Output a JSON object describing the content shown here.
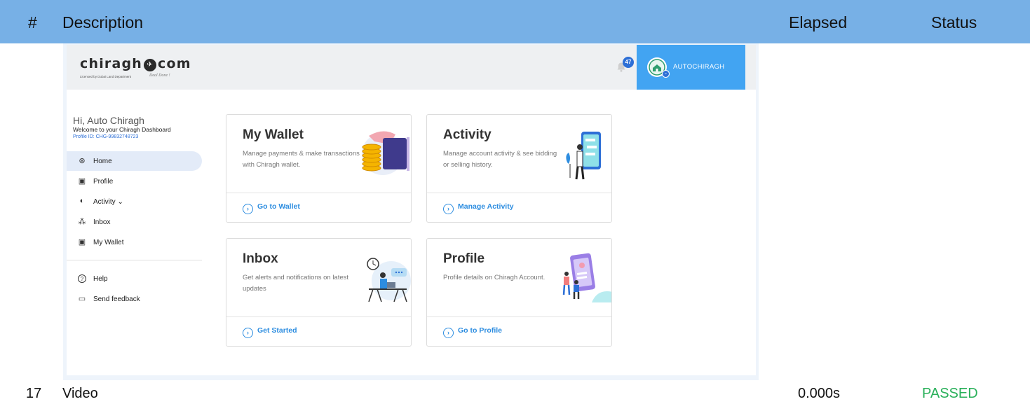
{
  "report": {
    "headers": {
      "num": "#",
      "description": "Description",
      "elapsed": "Elapsed",
      "status": "Status"
    },
    "row": {
      "num": "17",
      "description": "Video",
      "elapsed": "0.000s",
      "status": "PASSED"
    },
    "colors": {
      "header_bg": "#77b0e6",
      "passed": "#29b05a"
    }
  },
  "app": {
    "logo": {
      "word_left": "chiragh",
      "word_right": "com",
      "tagline": "Licensed by Dubai Land Department",
      "slogan": "Deal Done !"
    },
    "notifications": {
      "count": "47"
    },
    "user": {
      "name": "AUTOCHIRAGH"
    },
    "greeting": {
      "title": "Hi, Auto Chiragh",
      "subtitle": "Welcome to your Chiragh Dashboard",
      "profile_id": "Profile ID: CHG-99832748723"
    },
    "nav": [
      {
        "label": "Home",
        "icon": "account-circle-icon",
        "glyph": "⊛",
        "active": true
      },
      {
        "label": "Profile",
        "icon": "id-card-icon",
        "glyph": "▣"
      },
      {
        "label": "Activity",
        "icon": "toggle-icon",
        "glyph": "◐",
        "chevron": "⌄"
      },
      {
        "label": "Inbox",
        "icon": "group-icon",
        "glyph": "⁂"
      },
      {
        "label": "My Wallet",
        "icon": "wallet-card-icon",
        "glyph": "▣"
      }
    ],
    "nav_bottom": [
      {
        "label": "Help",
        "icon": "help-icon",
        "glyph": "?"
      },
      {
        "label": "Send feedback",
        "icon": "feedback-icon",
        "glyph": "▭"
      }
    ],
    "cards": [
      {
        "title": "My Wallet",
        "desc": "Manage payments & make transactions with Chiragh wallet.",
        "link": "Go to Wallet"
      },
      {
        "title": "Activity",
        "desc": "Manage account activity & see bidding or selling history.",
        "link": "Manage Activity"
      },
      {
        "title": "Inbox",
        "desc": "Get alerts and notifications on latest updates",
        "link": "Get Started"
      },
      {
        "title": "Profile",
        "desc": "Profile details on Chiragh Account.",
        "link": "Go to Profile"
      }
    ],
    "colors": {
      "accent": "#42a4f2",
      "link": "#2d8de0",
      "badge": "#2d6fd6"
    }
  }
}
